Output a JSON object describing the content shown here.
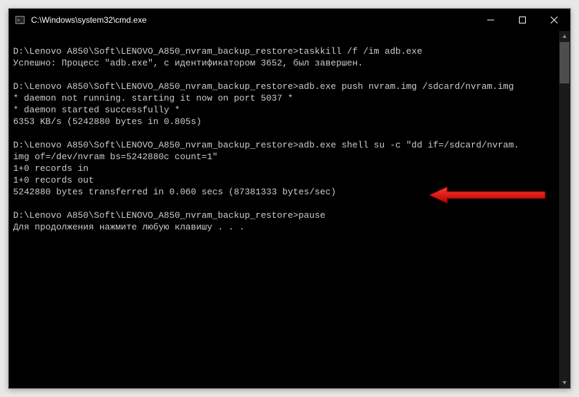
{
  "titlebar": {
    "title": "C:\\Windows\\system32\\cmd.exe"
  },
  "console": {
    "lines": [
      "",
      "D:\\Lenovo A850\\Soft\\LENOVO_A850_nvram_backup_restore>taskkill /f /im adb.exe",
      "Успешно: Процесс \"adb.exe\", с идентификатором 3652, был завершен.",
      "",
      "D:\\Lenovo A850\\Soft\\LENOVO_A850_nvram_backup_restore>adb.exe push nvram.img /sdcard/nvram.img",
      "* daemon not running. starting it now on port 5037 *",
      "* daemon started successfully *",
      "6353 KB/s (5242880 bytes in 0.805s)",
      "",
      "D:\\Lenovo A850\\Soft\\LENOVO_A850_nvram_backup_restore>adb.exe shell su -c \"dd if=/sdcard/nvram.",
      "img of=/dev/nvram bs=5242880c count=1\"",
      "1+0 records in",
      "1+0 records out",
      "5242880 bytes transferred in 0.060 secs (87381333 bytes/sec)",
      "",
      "D:\\Lenovo A850\\Soft\\LENOVO_A850_nvram_backup_restore>pause",
      "Для продолжения нажмите любую клавишу . . ."
    ]
  },
  "annotation": {
    "arrow_color": "#d40000"
  }
}
